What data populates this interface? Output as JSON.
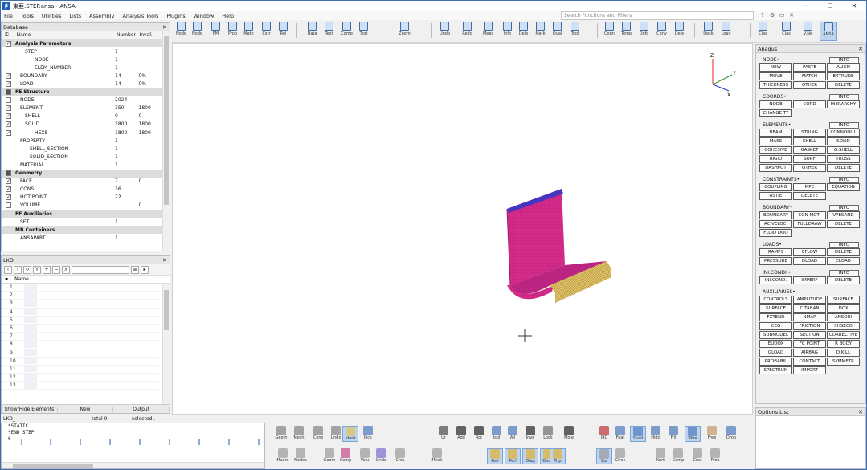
{
  "window": {
    "title": "東亜.STEP.ansa - ANSA",
    "search_placeholder": "Search Functions and Filters"
  },
  "menu": [
    "File",
    "Tools",
    "Utilities",
    "Lists",
    "Assembly",
    "Analysis Tools",
    "Plugins",
    "Window",
    "Help"
  ],
  "toolbar": [
    "Node",
    "Node",
    "FM",
    "Prop",
    "Mate",
    "Cstr",
    "Rel",
    "Data",
    "Text",
    "Comp",
    "Test",
    "Zoom",
    "Undo",
    "Redo",
    "Meas",
    "Info",
    "Dele",
    "Mark",
    "Qual",
    "Tool",
    "Conn",
    "Temp",
    "Defo",
    "Conv",
    "Dele",
    "Deck",
    "Load",
    "Clas",
    "Clas",
    "V.Ne",
    "ANSA"
  ],
  "database": {
    "title": "Database",
    "col_name": "Name",
    "col_number": "Number",
    "col_value": "Inval.",
    "rows": [
      {
        "name": "Analysis Parameters",
        "num": "",
        "val": "",
        "sec": true,
        "cb": "on"
      },
      {
        "name": "STEP",
        "num": "1",
        "val": "",
        "cb": "",
        "ind": 2
      },
      {
        "name": "NODE",
        "num": "1",
        "val": "",
        "cb": "",
        "ind": 4
      },
      {
        "name": "ELEM_NUMBER",
        "num": "1",
        "val": "",
        "cb": "",
        "ind": 4
      },
      {
        "name": "BOUNDARY",
        "num": "14",
        "val": "0%",
        "cb": "on",
        "ind": 1
      },
      {
        "name": "LOAD",
        "num": "14",
        "val": "0%",
        "cb": "on",
        "ind": 1
      },
      {
        "name": "FE Structure",
        "num": "",
        "val": "",
        "sec": true,
        "cb": "fill"
      },
      {
        "name": "NODE",
        "num": "2024",
        "val": "",
        "cb": "off",
        "ind": 1
      },
      {
        "name": "ELEMENT",
        "num": "350",
        "val": "1800",
        "cb": "on",
        "ind": 1
      },
      {
        "name": "SHELL",
        "num": "0",
        "val": "0",
        "cb": "on",
        "ind": 2
      },
      {
        "name": "SOLID",
        "num": "1800",
        "val": "1800",
        "cb": "on",
        "ind": 2
      },
      {
        "name": "HEX8",
        "num": "1800",
        "val": "1800",
        "cb": "on",
        "ind": 4
      },
      {
        "name": "PROPERTY",
        "num": "1",
        "val": "",
        "cb": "",
        "ind": 1
      },
      {
        "name": "SHELL_SECTION",
        "num": "1",
        "val": "",
        "cb": "",
        "ind": 3
      },
      {
        "name": "SOLID_SECTION",
        "num": "1",
        "val": "",
        "cb": "",
        "ind": 3
      },
      {
        "name": "MATERIAL",
        "num": "1",
        "val": "",
        "cb": "",
        "ind": 1
      },
      {
        "name": "Geometry",
        "num": "",
        "val": "",
        "sec": true,
        "cb": "fill"
      },
      {
        "name": "FACE",
        "num": "7",
        "val": "0",
        "cb": "on",
        "ind": 1
      },
      {
        "name": "CONS",
        "num": "16",
        "val": "",
        "cb": "on",
        "ind": 1
      },
      {
        "name": "HOT POINT",
        "num": "22",
        "val": "",
        "cb": "on",
        "ind": 1
      },
      {
        "name": "VOLUME",
        "num": "",
        "val": "0",
        "cb": "off",
        "ind": 1
      },
      {
        "name": "FE Auxiliaries",
        "num": "",
        "val": "",
        "sec": true,
        "cb": ""
      },
      {
        "name": "SET",
        "num": "1",
        "val": "",
        "cb": "",
        "ind": 1
      },
      {
        "name": "MB Containers",
        "num": "",
        "val": "",
        "sec": true,
        "cb": ""
      },
      {
        "name": "ANSAPART",
        "num": "1",
        "val": "",
        "cb": "",
        "ind": 1
      }
    ]
  },
  "lkd": {
    "title": "LKD",
    "col_name": "Name",
    "rows": [
      "1",
      "2",
      "3",
      "4",
      "5",
      "6",
      "7",
      "8",
      "9",
      "10",
      "11",
      "12",
      "13"
    ],
    "footer": [
      "Show/Hide Elements",
      "New",
      "Output"
    ]
  },
  "status": {
    "left": "LKD_",
    "mid": "total 0.",
    "right": "selected ."
  },
  "console": [
    "*STATIC",
    "*END STEP",
    "0"
  ],
  "right_panel": {
    "title": "Abaqus",
    "sections": [
      {
        "label": "NODE",
        "info": "INFO",
        "buttons": [
          "NEW",
          "PASTE",
          "ALIGN",
          "MOVE",
          "MATCH",
          "EXTRUDE",
          "THICKNESS",
          "OTHER",
          "DELETE"
        ]
      },
      {
        "label": "COORDS",
        "info": "INFO",
        "buttons": [
          "NODE",
          "CORD",
          "HIERARCHY",
          "CHANGE TY"
        ]
      },
      {
        "label": "ELEMENTS",
        "info": "INFO",
        "buttons": [
          "BEAM",
          "STRING",
          "CONNODUL",
          "MASS",
          "SHELL",
          "SOLID",
          "COHESIVE",
          "GASKET",
          "G.SHELL",
          "RIGID",
          "SURF",
          "TRUSS",
          "DASHPOT",
          "OTHER",
          "DELETE"
        ]
      },
      {
        "label": "CONSTRAINTS",
        "info": "INFO",
        "buttons": [
          "COUPLING",
          "MPC",
          "EQUATION",
          "ASTIE",
          "DELETE"
        ]
      },
      {
        "label": "BOUNDARY",
        "info": "INFO",
        "buttons": [
          "BOUNDARY",
          "CON MOTI",
          "VPESAND",
          "AC VELOCI",
          "FULLDRAW",
          "DELETE",
          "FLUID DOO"
        ]
      },
      {
        "label": "LOADS",
        "info": "INFO",
        "buttons": [
          "RAMPS",
          "CFLOW",
          "DELETE",
          "PRESSURE",
          "DLOAD",
          "CLOAD"
        ]
      },
      {
        "label": "INI.CONDI.",
        "info": "INFO",
        "buttons": [
          "INI.COND.",
          "IMPERF",
          "DELETE"
        ]
      },
      {
        "label": "AUXILIARIES",
        "info": "",
        "buttons": [
          "CONTROLS",
          "AMPLITUDE",
          "SURFACE",
          "SURFACE",
          "C.TABAN",
          "DOX",
          "FXTEND",
          "NMAP",
          "ANSORI",
          "CEG",
          "FRICTION",
          "SHSECO",
          "SUBMODEL",
          "SECTION",
          "CORRECTIVE",
          "EUDOX",
          "FC POINT",
          "R BODY",
          "GLOAD",
          "AIRBAG",
          "D.KILL",
          "PROBABIL",
          "CONTACT",
          "SYMMETR",
          "SPECTRUM",
          "IMPORT"
        ]
      }
    ]
  },
  "options_list": {
    "title": "Options List"
  },
  "bottom_tools": [
    "Geom",
    "Mesh",
    "Cons",
    "Undo",
    "Ident",
    "Pick",
    "Ur",
    "Add",
    "Rot",
    "Isol",
    "All",
    "Inve",
    "Lock",
    "Mole",
    "PID",
    "Feat",
    "Shad",
    "Hidd",
    "Fill",
    "Wire",
    "Free",
    "Drop"
  ],
  "bottom_tools_2": [
    "Macro",
    "Nodes",
    "Geom",
    "Comp",
    "Volu",
    "Grids",
    "Cros",
    "Mesh",
    "Perl",
    "Perl",
    "Diag",
    "Doub",
    "Trip",
    "Sur",
    "Chec",
    "Kurt",
    "Comp",
    "Cros",
    "Prob"
  ],
  "colors": {
    "magenta": "#d42a8a",
    "dark_magenta": "#9b1a63",
    "blue_edge": "#2b37c9",
    "yellow": "#e0c466",
    "selected": "#bcd4f0"
  }
}
